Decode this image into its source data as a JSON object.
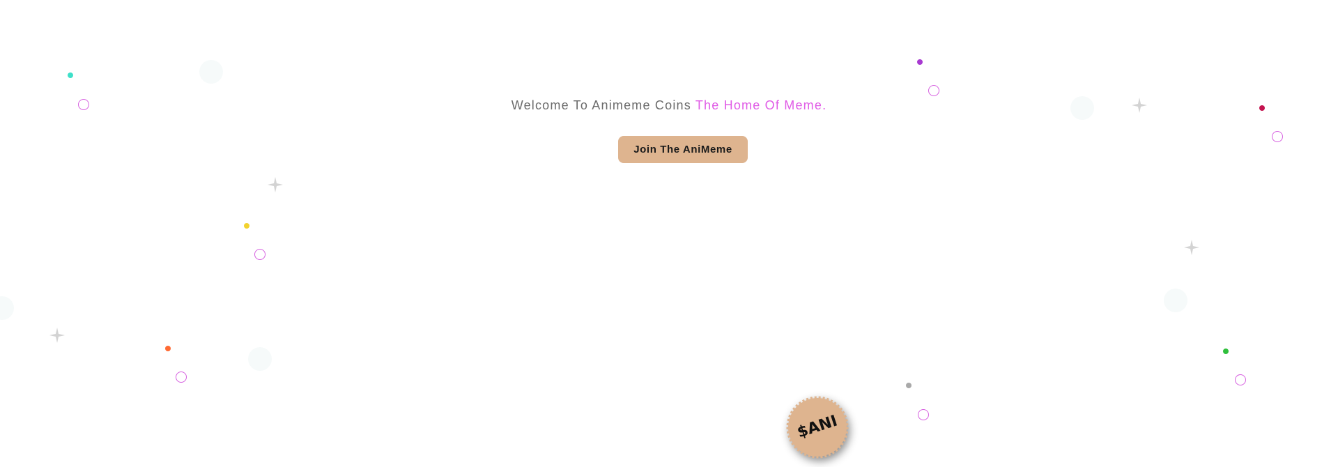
{
  "hero": {
    "welcome_text": "Welcome To Animeme Coins",
    "accent_text": "The Home Of Meme.",
    "join_button_label": "Join The AniMeme"
  },
  "coin_badge": {
    "label": "$ANI"
  },
  "colors": {
    "accent_pink": "#e05ce6",
    "button_tan": "#deb48f",
    "text_gray": "#6b6b6b",
    "sparkle_gray": "#d3d3d3"
  },
  "decorations": {
    "dot_colors": [
      "#3ee0c9",
      "#a83ad1",
      "#c4134f",
      "#f2d22e",
      "#ff6a33",
      "#2fbf3c",
      "#a9a9a9"
    ],
    "icon_names": [
      "dot",
      "ring",
      "sparkle-icon",
      "coin-icon"
    ]
  }
}
